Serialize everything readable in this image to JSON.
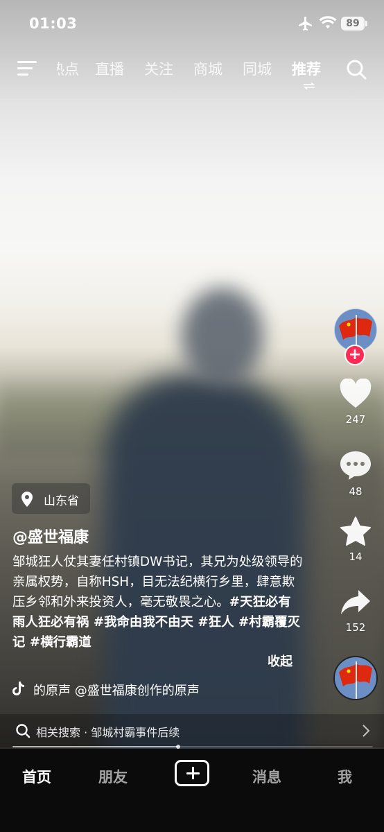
{
  "status_bar": {
    "time": "01:03",
    "battery": "89",
    "icons": [
      "airplane-icon",
      "wifi-icon",
      "battery-icon"
    ]
  },
  "top_nav": {
    "tabs": [
      {
        "label": "热点",
        "active": false
      },
      {
        "label": "直播",
        "active": false
      },
      {
        "label": "关注",
        "active": false
      },
      {
        "label": "商城",
        "active": false
      },
      {
        "label": "同城",
        "active": false
      },
      {
        "label": "推荐",
        "active": true
      }
    ],
    "icons": [
      "menu-icon",
      "search-icon"
    ]
  },
  "video": {
    "location": "山东省",
    "author": "@盛世福康",
    "description": "邹城狂人仗其妻任村镇DW书记，其兄为处级领导的亲属权势，自称HSH，目无法纪横行乡里，肆意欺压乡邻和外来投资人，毫无敬畏之心。",
    "hashtags": "#天狂必有雨人狂必有祸 #我命由我不由天 #狂人 #村霸覆灭记 #横行霸道",
    "collapse_label": "收起",
    "music": "的原声    @盛世福康创作的原声",
    "progress_fraction": 0.46
  },
  "right_rail": {
    "likes": "247",
    "comments": "48",
    "favorites": "14",
    "shares": "152",
    "follow_symbol": "+"
  },
  "related_search": {
    "text": "相关搜索 · 邹城村霸事件后续"
  },
  "bottom_tabs": [
    {
      "label": "首页",
      "active": true
    },
    {
      "label": "朋友",
      "active": false
    },
    {
      "label": "消息",
      "active": false
    },
    {
      "label": "我",
      "active": false
    }
  ],
  "colors": {
    "accent": "#fe2c55",
    "tabbar_bg": "#0b0b0b",
    "flag_red": "#de2910",
    "flag_yellow": "#ffde00"
  }
}
